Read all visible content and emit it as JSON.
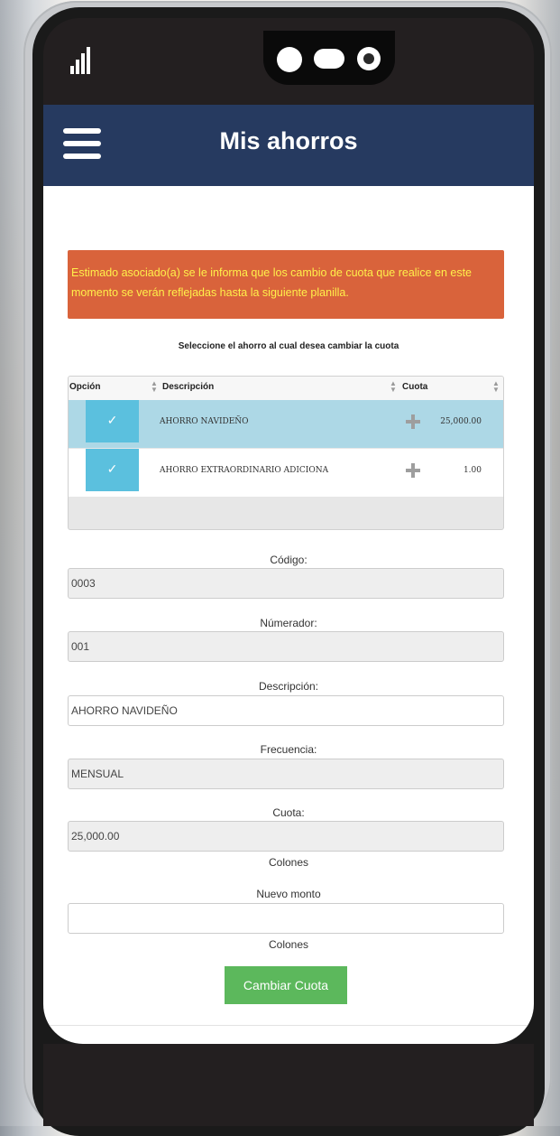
{
  "app": {
    "title": "Mis ahorros"
  },
  "alert": {
    "text": "Estimado asociado(a) se le informa que los cambio de cuota que realice en este momento se verán reflejadas hasta la siguiente planilla."
  },
  "instruction": "Seleccione el ahorro al cual desea cambiar la cuota",
  "table": {
    "columns": [
      "Opción",
      "Descripción",
      "Cuota"
    ],
    "rows": [
      {
        "check": "✓",
        "descripcion": "AHORRO NAVIDEÑO",
        "cuota": "25,000.00",
        "selected": true
      },
      {
        "check": "✓",
        "descripcion": "AHORRO EXTRAORDINARIO ADICIONA",
        "cuota": "1.00",
        "selected": false
      }
    ]
  },
  "form": {
    "codigo": {
      "label": "Código:",
      "value": "0003"
    },
    "numerador": {
      "label": "Númerador:",
      "value": "001"
    },
    "descripcion": {
      "label": "Descripción:",
      "value": "AHORRO NAVIDEÑO"
    },
    "frecuencia": {
      "label": "Frecuencia:",
      "value": "MENSUAL"
    },
    "cuota": {
      "label": "Cuota:",
      "value": "25,000.00",
      "unit": "Colones"
    },
    "nuevo_monto": {
      "label": "Nuevo monto",
      "value": "",
      "unit": "Colones"
    },
    "submit_label": "Cambiar Cuota"
  },
  "icons": {
    "menu": "hamburger-icon",
    "signal": "signal-bars-icon",
    "sort": "sort-icon",
    "add": "plus-icon"
  },
  "colors": {
    "header": "#263a60",
    "alert_bg": "#d9633b",
    "alert_text": "#fff04a",
    "selected_row": "#add8e6",
    "check_button": "#5bc0de",
    "submit": "#5cb85c"
  }
}
